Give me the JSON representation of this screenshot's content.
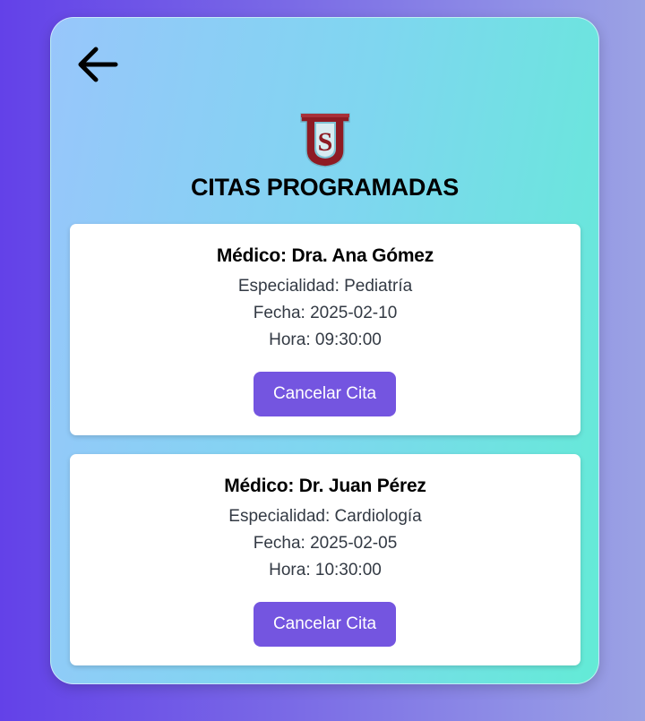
{
  "header": {
    "back_icon": "arrow-left-icon",
    "logo_icon": "us-shield-logo-icon",
    "title": "CITAS PROGRAMADAS"
  },
  "appointments": [
    {
      "doctor": "Médico: Dra. Ana Gómez",
      "specialty": "Especialidad: Pediatría",
      "date": "Fecha: 2025-02-10",
      "time": "Hora: 09:30:00",
      "cancel_label": "Cancelar Cita"
    },
    {
      "doctor": "Médico: Dr. Juan Pérez",
      "specialty": "Especialidad: Cardiología",
      "date": "Fecha: 2025-02-05",
      "time": "Hora: 10:30:00",
      "cancel_label": "Cancelar Cita"
    }
  ],
  "colors": {
    "accent_button": "#7455e0",
    "background_start": "#6341e8",
    "panel_start": "#98c6fb",
    "panel_end": "#63ebd6",
    "logo_red": "#8e1b24"
  }
}
